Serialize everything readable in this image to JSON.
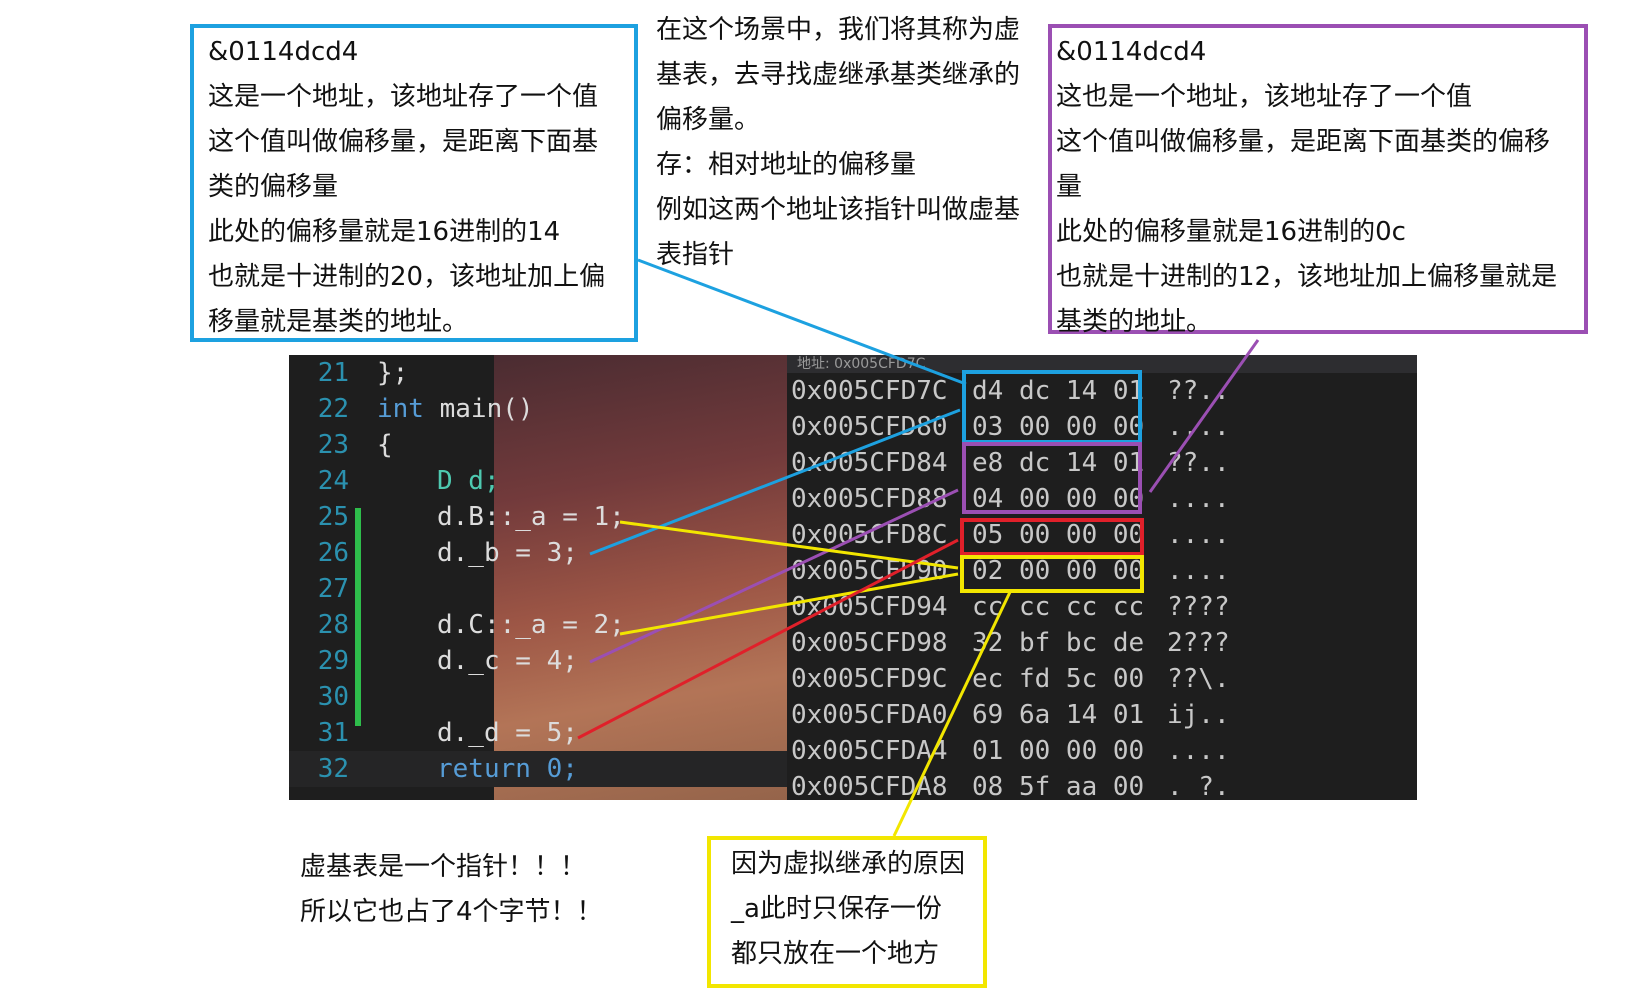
{
  "colors": {
    "blue": "#1da1e0",
    "purple": "#9b4fb3",
    "red": "#e0202a",
    "yellow": "#f2e600",
    "green": "#2ebd4b"
  },
  "note_blue": {
    "lines": [
      "&0114dcd4",
      "这是一个地址，该地址存了一个值",
      "这个值叫做偏移量，是距离下面基",
      "类的偏移量",
      "此处的偏移量就是16进制的14",
      "也就是十进制的20，该地址加上偏",
      "移量就是基类的地址。"
    ]
  },
  "note_middle": {
    "lines": [
      "在这个场景中，我们将其称为虚",
      "基表，去寻找虚继承基类继承的",
      "偏移量。",
      "存：相对地址的偏移量",
      "例如这两个地址该指针叫做虚基",
      "表指针"
    ]
  },
  "note_purple": {
    "lines": [
      "&0114dcd4",
      "这也是一个地址，该地址存了一个值",
      "这个值叫做偏移量，是距离下面基类的偏移",
      "量",
      "此处的偏移量就是16进制的0c",
      "也就是十进制的12，该地址加上偏移量就是",
      "基类的地址。"
    ]
  },
  "note_bottom_left": {
    "lines": [
      "虚基表是一个指针！！！",
      "所以它也占了4个字节！！"
    ]
  },
  "note_yellow": {
    "lines": [
      "因为虚拟继承的原因",
      "_a此时只保存一份",
      "都只放在一个地方"
    ]
  },
  "code": {
    "lines": [
      {
        "ln": "21",
        "text": "};"
      },
      {
        "ln": "22",
        "text": "int main()"
      },
      {
        "ln": "23",
        "text": "{"
      },
      {
        "ln": "24",
        "text": "D d;"
      },
      {
        "ln": "25",
        "text": "d.B::_a = 1;"
      },
      {
        "ln": "26",
        "text": "d._b = 3;"
      },
      {
        "ln": "27",
        "text": ""
      },
      {
        "ln": "28",
        "text": "d.C::_a = 2;"
      },
      {
        "ln": "29",
        "text": "d._c = 4;"
      },
      {
        "ln": "30",
        "text": ""
      },
      {
        "ln": "31",
        "text": "d._d = 5;"
      },
      {
        "ln": "32",
        "text": "return 0;"
      }
    ]
  },
  "memory": {
    "header": "地址: 0x005CFD7C",
    "rows": [
      {
        "addr": "0x005CFD7C",
        "bytes": "d4 dc 14 01",
        "ascii": "??.."
      },
      {
        "addr": "0x005CFD80",
        "bytes": "03 00 00 00",
        "ascii": "...."
      },
      {
        "addr": "0x005CFD84",
        "bytes": "e8 dc 14 01",
        "ascii": "??.."
      },
      {
        "addr": "0x005CFD88",
        "bytes": "04 00 00 00",
        "ascii": "...."
      },
      {
        "addr": "0x005CFD8C",
        "bytes": "05 00 00 00",
        "ascii": "...."
      },
      {
        "addr": "0x005CFD90",
        "bytes": "02 00 00 00",
        "ascii": "...."
      },
      {
        "addr": "0x005CFD94",
        "bytes": "cc cc cc cc",
        "ascii": "????"
      },
      {
        "addr": "0x005CFD98",
        "bytes": "32 bf bc de",
        "ascii": "2???"
      },
      {
        "addr": "0x005CFD9C",
        "bytes": "ec fd 5c 00",
        "ascii": "??\\."
      },
      {
        "addr": "0x005CFDA0",
        "bytes": "69 6a 14 01",
        "ascii": "ij.."
      },
      {
        "addr": "0x005CFDA4",
        "bytes": "01 00 00 00",
        "ascii": "...."
      },
      {
        "addr": "0x005CFDA8",
        "bytes": "08 5f aa 00",
        "ascii": "._?."
      }
    ]
  }
}
